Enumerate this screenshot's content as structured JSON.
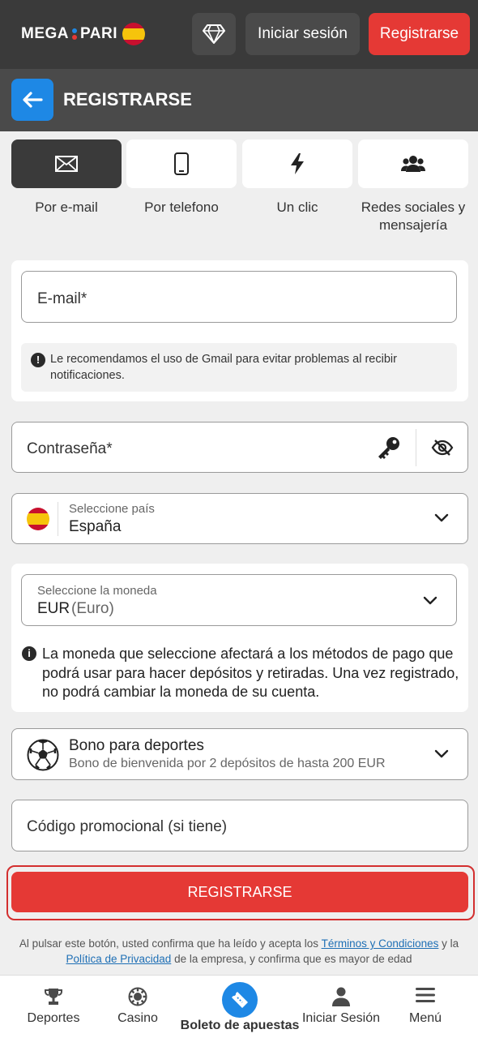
{
  "header": {
    "logo_left": "MEGA",
    "logo_right": "PARI",
    "login_label": "Iniciar sesión",
    "register_label": "Registrarse",
    "gem_icon": "diamond-icon"
  },
  "subheader": {
    "title": "REGISTRARSE",
    "back_icon": "arrow-left-icon"
  },
  "methods": [
    {
      "label": "Por e-mail",
      "icon": "envelope-icon",
      "active": true
    },
    {
      "label": "Por telefono",
      "icon": "phone-icon",
      "active": false
    },
    {
      "label": "Un clic",
      "icon": "lightning-icon",
      "active": false
    },
    {
      "label": "Redes sociales y mensajería",
      "icon": "users-icon",
      "active": false
    }
  ],
  "email": {
    "placeholder": "E-mail*",
    "hint": "Le recomendamos el uso de Gmail para evitar problemas al recibir notificaciones."
  },
  "password": {
    "placeholder": "Contraseña*"
  },
  "country": {
    "label": "Seleccione país",
    "value": "España"
  },
  "currency": {
    "label": "Seleccione la moneda",
    "code": "EUR",
    "name": "(Euro)",
    "info": "La moneda que seleccione afectará a los métodos de pago que podrá usar para hacer depósitos y retiradas. Una vez registrado, no podrá cambiar la moneda de su cuenta."
  },
  "bonus": {
    "title": "Bono para deportes",
    "subtitle": "Bono de bienvenida por 2 depósitos de hasta 200 EUR"
  },
  "promo": {
    "placeholder": "Código promocional (si tiene)"
  },
  "submit_label": "REGISTRARSE",
  "legal": {
    "part1": "Al pulsar este botón, usted confirma que ha leído y acepta los",
    "terms": "Términos y Condiciones",
    "part2": "y la",
    "privacy": "Política de Privacidad",
    "part3": "de la empresa, y confirma que es mayor de edad"
  },
  "bottom_nav": [
    {
      "label": "Deportes",
      "icon": "trophy-icon"
    },
    {
      "label": "Casino",
      "icon": "casino-chip-icon"
    },
    {
      "label": "Boleto de apuestas",
      "icon": "ticket-icon"
    },
    {
      "label": "Iniciar Sesión",
      "icon": "user-icon"
    },
    {
      "label": "Menú",
      "icon": "hamburger-icon"
    }
  ],
  "colors": {
    "accent_red": "#e53935",
    "accent_blue": "#1e88e5",
    "header_dark": "#3a3a3a"
  }
}
